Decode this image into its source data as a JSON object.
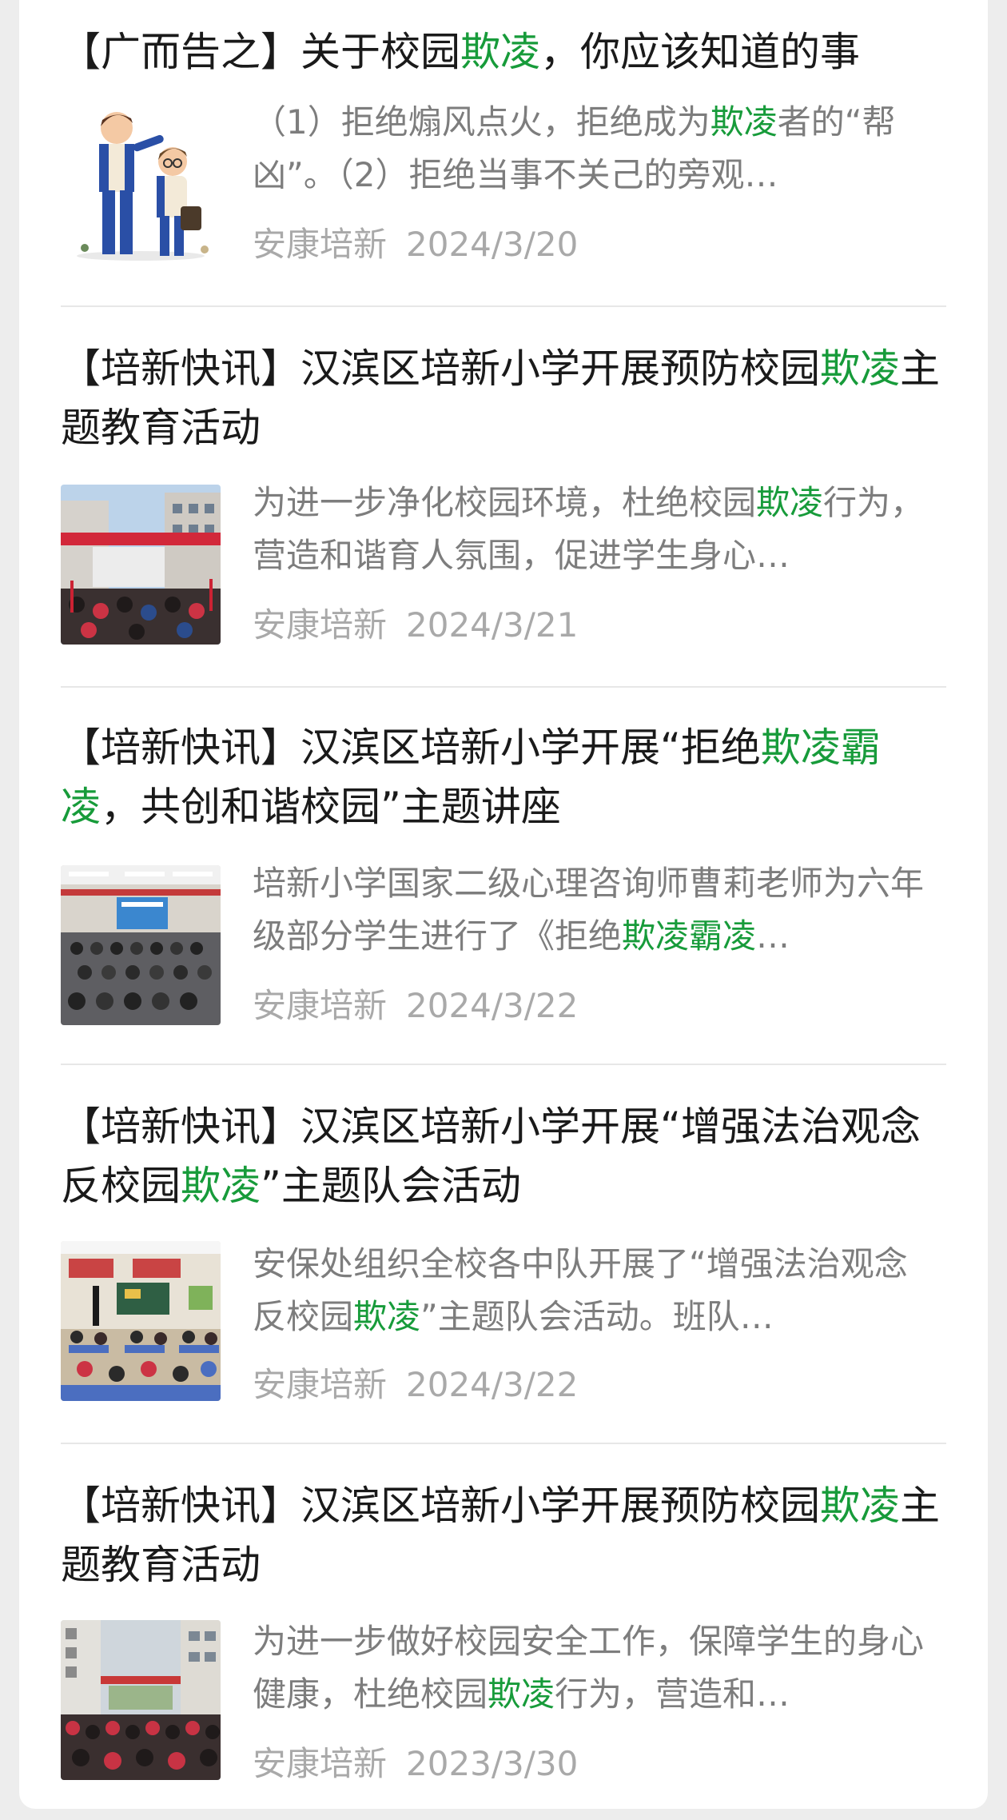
{
  "articles": [
    {
      "title": [
        "【广而告之】关于校园",
        "欺凌",
        "，你应该知道的事"
      ],
      "summary": [
        "（1）拒绝煽风点火，拒绝成为",
        "欺凌",
        "者的“帮凶”。（2）拒绝当事不关己的旁观…"
      ],
      "source": "安康培新",
      "date": "2024/3/20"
    },
    {
      "title": [
        "【培新快讯】汉滨区培新小学开展预防校园",
        "欺凌",
        "主题教育活动"
      ],
      "summary": [
        "为进一步净化校园环境，杜绝校园",
        "欺凌",
        "行为，营造和谐育人氛围，促进学生身心…"
      ],
      "source": "安康培新",
      "date": "2024/3/21"
    },
    {
      "title": [
        "【培新快讯】汉滨区培新小学开展“拒绝",
        "欺凌霸凌",
        "，共创和谐校园”主题讲座"
      ],
      "summary": [
        "培新小学国家二级心理咨询师曹莉老师为六年级部分学生进行了《拒绝",
        "欺凌霸凌",
        "…"
      ],
      "source": "安康培新",
      "date": "2024/3/22"
    },
    {
      "title": [
        "【培新快讯】汉滨区培新小学开展“增强法治观念 反校园",
        "欺凌",
        "”主题队会活动"
      ],
      "summary": [
        "安保处组织全校各中队开展了“增强法治观念 反校园",
        "欺凌",
        "”主题队会活动。班队…"
      ],
      "source": "安康培新",
      "date": "2024/3/22"
    },
    {
      "title": [
        "【培新快讯】汉滨区培新小学开展预防校园",
        "欺凌",
        "主题教育活动"
      ],
      "summary": [
        "为进一步做好校园安全工作，保障学生的身心健康，杜绝校园",
        "欺凌",
        "行为，营造和…"
      ],
      "source": "安康培新",
      "date": "2023/3/30"
    }
  ],
  "colors": {
    "highlight": "#179b3a",
    "title": "#1a1a1a",
    "summary": "#7d7d7d",
    "meta": "#a9a9a9"
  }
}
